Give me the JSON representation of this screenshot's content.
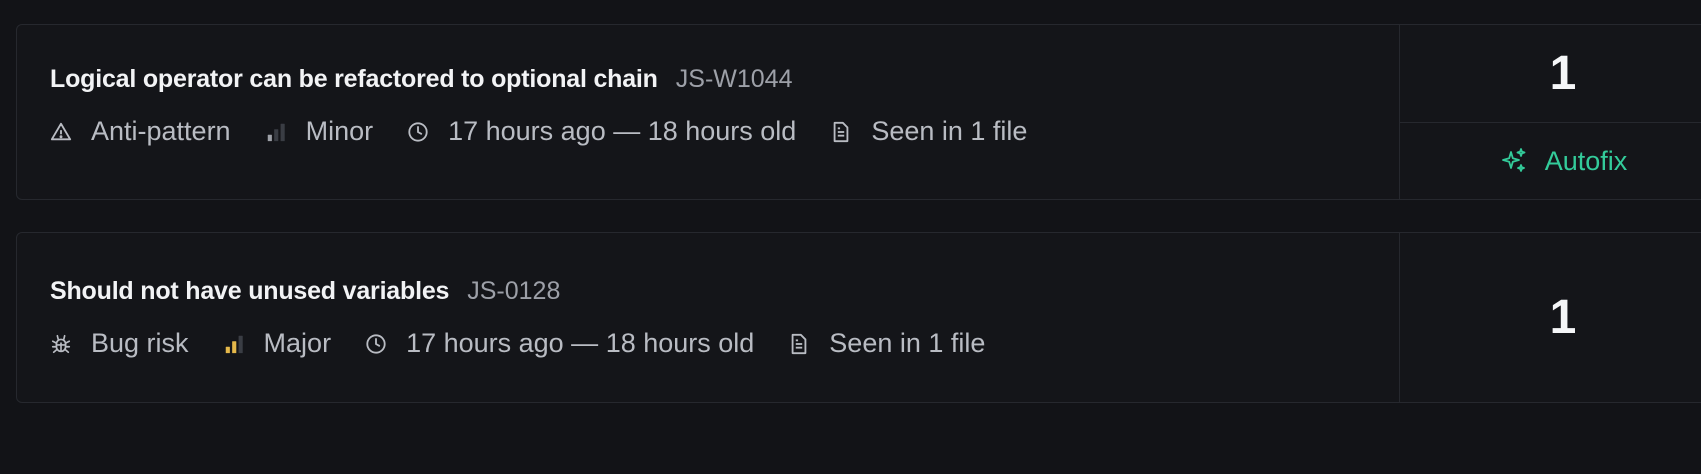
{
  "issues": [
    {
      "title": "Logical operator can be refactored to optional chain",
      "shortcode": "JS-W1044",
      "category": "Anti-pattern",
      "category_icon": "warning-triangle-icon",
      "severity": "Minor",
      "severity_level": 1,
      "severity_color": "#9ea1a8",
      "time": "17 hours ago — 18 hours old",
      "occurrence": "Seen in 1 file",
      "count": "1",
      "autofix_label": "Autofix"
    },
    {
      "title": "Should not have unused variables",
      "shortcode": "JS-0128",
      "category": "Bug risk",
      "category_icon": "bug-icon",
      "severity": "Major",
      "severity_level": 2,
      "severity_color": "#e5b84a",
      "time": "17 hours ago — 18 hours old",
      "occurrence": "Seen in 1 file",
      "count": "1"
    }
  ],
  "colors": {
    "background": "#121317",
    "card_border": "#26282e",
    "autofix_accent": "#33cb9a"
  }
}
